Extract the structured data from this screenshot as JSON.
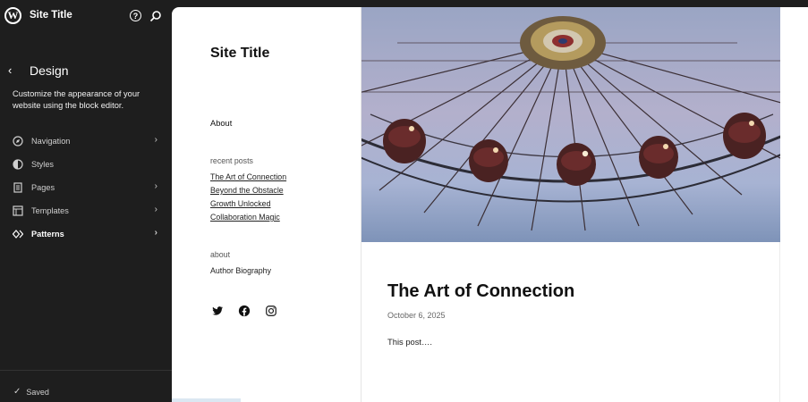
{
  "topbar": {
    "site_name": "Site Title",
    "help_symbol": "?",
    "logo_icon": "wordpress-logo-icon",
    "help_icon": "help-icon",
    "search_icon": "search-icon"
  },
  "design": {
    "back_symbol": "‹",
    "title": "Design",
    "description": "Customize the appearance of your website using the block editor."
  },
  "nav": {
    "items": [
      {
        "label": "Navigation",
        "icon": "navigation-icon",
        "chevron": "›"
      },
      {
        "label": "Styles",
        "icon": "styles-icon",
        "chevron": ""
      },
      {
        "label": "Pages",
        "icon": "pages-icon",
        "chevron": "›"
      },
      {
        "label": "Templates",
        "icon": "templates-icon",
        "chevron": "›"
      },
      {
        "label": "Patterns",
        "icon": "patterns-icon",
        "chevron": "›"
      }
    ]
  },
  "status": {
    "check": "✓",
    "saved_label": "Saved"
  },
  "preview": {
    "site_title": "Site Title",
    "about_link": "About",
    "recent_posts_heading": "recent posts",
    "recent_posts": [
      "The Art of Connection",
      "Beyond the Obstacle",
      "Growth Unlocked",
      "Collaboration Magic"
    ],
    "about_heading": "about",
    "author_bio": "Author Biography",
    "social": [
      "twitter-icon",
      "facebook-icon",
      "instagram-icon"
    ],
    "hero_image": "ferris-wheel-photo",
    "post": {
      "title": "The Art of Connection",
      "date": "October 6, 2025",
      "excerpt": "This post…."
    }
  },
  "colors": {
    "sidebar_bg": "#1e1e1e",
    "canvas_bg": "#ffffff",
    "text_dark": "#111111"
  }
}
